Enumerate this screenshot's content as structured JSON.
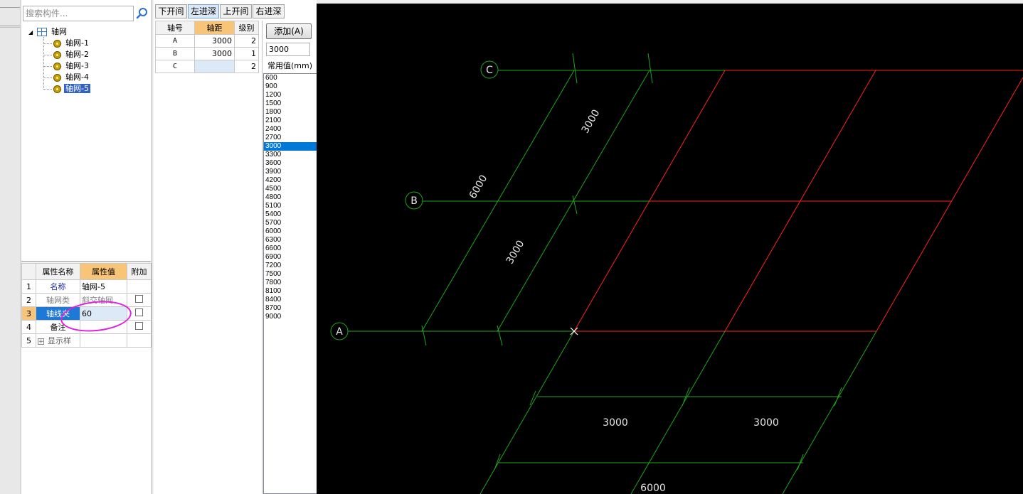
{
  "search": {
    "placeholder": "搜索构件..."
  },
  "tree": {
    "root": "轴网",
    "items": [
      "轴网-1",
      "轴网-2",
      "轴网-3",
      "轴网-4",
      "轴网-5"
    ],
    "selected_index": 4
  },
  "properties": {
    "headers": [
      "属性名称",
      "属性值",
      "附加"
    ],
    "rows": [
      {
        "num": "1",
        "name": "名称",
        "value": "轴网-5"
      },
      {
        "num": "2",
        "name": "轴网类",
        "value": "斜交轴网"
      },
      {
        "num": "3",
        "name": "轴线夹",
        "value": "60"
      },
      {
        "num": "4",
        "name": "备注",
        "value": ""
      },
      {
        "num": "5",
        "name": "显示样",
        "value": ""
      }
    ],
    "expand_symbol": "+"
  },
  "tabs": [
    "下开间",
    "左进深",
    "上开间",
    "右进深"
  ],
  "active_tab": "左进深",
  "axis_table": {
    "headers": [
      "轴号",
      "轴距",
      "级别"
    ],
    "rows": [
      {
        "axis": "A",
        "distance": "3000",
        "level": "2"
      },
      {
        "axis": "B",
        "distance": "3000",
        "level": "1"
      },
      {
        "axis": "C",
        "distance": "",
        "level": "2"
      }
    ]
  },
  "add_button": "添加(A)",
  "value_input": "3000",
  "common_values_label": "常用值(mm)",
  "common_values": [
    "600",
    "900",
    "1200",
    "1500",
    "1800",
    "2100",
    "2400",
    "2700",
    "3000",
    "3300",
    "3600",
    "3900",
    "4200",
    "4500",
    "4800",
    "5100",
    "5400",
    "5700",
    "6000",
    "6300",
    "6600",
    "6900",
    "7200",
    "7500",
    "7800",
    "8100",
    "8400",
    "8700",
    "9000"
  ],
  "selected_common_value": "3000",
  "canvas": {
    "axis_labels": [
      "A",
      "B",
      "C"
    ],
    "dimensions": {
      "left_total": "6000",
      "left_upper": "3000",
      "left_lower": "3000",
      "bottom_1": "3000",
      "bottom_2": "3000",
      "bottom_total": "6000"
    },
    "grid_color": "#ff2020",
    "dim_color": "#1fa51f",
    "text_color": "#e6e6e6"
  },
  "icons": {
    "search": "search-icon",
    "axis_grid": "axis-grid-icon",
    "component": "gear-icon"
  }
}
